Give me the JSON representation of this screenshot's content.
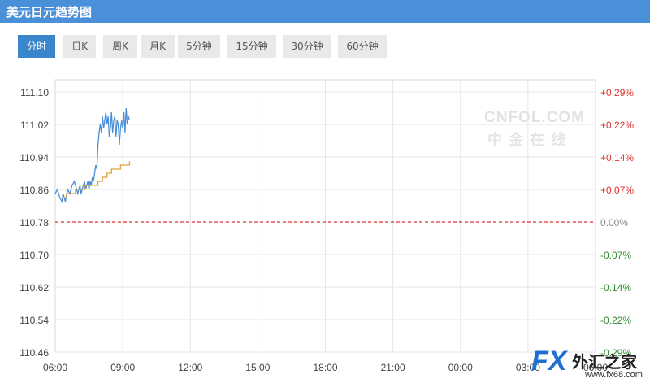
{
  "header": {
    "title": "美元日元趋势图"
  },
  "tabs": [
    {
      "label": "分时",
      "active": true
    },
    {
      "label": "日K",
      "active": false
    },
    {
      "label": "周K",
      "active": false
    },
    {
      "label": "月K",
      "active": false
    },
    {
      "label": "5分钟",
      "active": false
    },
    {
      "label": "15分钟",
      "active": false
    },
    {
      "label": "30分钟",
      "active": false
    },
    {
      "label": "60分钟",
      "active": false
    }
  ],
  "watermark": {
    "line1": "CNFOL.COM",
    "line2": "中金在线"
  },
  "logo": {
    "fx": "FX",
    "name": "外汇之家",
    "url": "www.fx68.com"
  },
  "colors": {
    "accent": "#3a86cc",
    "title_bar": "#4a90d9",
    "up": "#e03030",
    "down": "#2e8b2e",
    "price_line": "#4a8fd6",
    "avg_line": "#e0a040",
    "baseline": "#e03030"
  },
  "chart_data": {
    "type": "line",
    "title": "",
    "xlabel": "",
    "ylabel": "",
    "ylim": [
      110.46,
      111.1
    ],
    "base_price": 110.78,
    "y_ticks": [
      "111.10",
      "111.02",
      "110.94",
      "110.86",
      "110.78",
      "110.70",
      "110.62",
      "110.54",
      "110.46"
    ],
    "pct_ticks": [
      "+0.29%",
      "+0.22%",
      "+0.14%",
      "+0.07%",
      "0.00%",
      "-0.07%",
      "-0.14%",
      "-0.22%",
      "-0.29%"
    ],
    "x_ticks": [
      "06:00",
      "09:00",
      "12:00",
      "15:00",
      "18:00",
      "21:00",
      "00:00",
      "03:00",
      "06:00"
    ],
    "x_range_hours": [
      0,
      24
    ],
    "grid": true,
    "series": [
      {
        "kind": "price",
        "x": [
          0.0,
          0.1,
          0.2,
          0.3,
          0.35,
          0.45,
          0.55,
          0.65,
          0.75,
          0.85,
          0.95,
          1.0,
          1.05,
          1.1,
          1.15,
          1.25,
          1.3,
          1.35,
          1.4,
          1.45,
          1.5,
          1.55,
          1.6,
          1.65,
          1.7,
          1.75,
          1.8,
          1.85,
          1.9,
          1.95,
          2.0,
          2.05,
          2.1,
          2.15,
          2.2,
          2.25,
          2.3,
          2.35,
          2.4,
          2.45,
          2.5,
          2.55,
          2.6,
          2.65,
          2.7,
          2.75,
          2.8,
          2.85,
          2.9,
          2.95,
          3.0,
          3.05,
          3.1,
          3.15,
          3.2,
          3.25,
          3.3
        ],
        "y": [
          110.85,
          110.86,
          110.84,
          110.83,
          110.85,
          110.83,
          110.86,
          110.85,
          110.87,
          110.88,
          110.86,
          110.85,
          110.86,
          110.87,
          110.85,
          110.87,
          110.88,
          110.86,
          110.87,
          110.88,
          110.86,
          110.88,
          110.87,
          110.89,
          110.88,
          110.9,
          110.92,
          110.91,
          110.97,
          111.0,
          111.02,
          111.0,
          111.04,
          111.01,
          111.03,
          111.05,
          111.02,
          111.04,
          110.99,
          111.01,
          111.05,
          111.0,
          111.03,
          111.04,
          110.99,
          111.03,
          111.02,
          110.97,
          111.01,
          111.03,
          111.01,
          111.05,
          111.0,
          111.06,
          111.02,
          111.04,
          111.03
        ]
      },
      {
        "kind": "average",
        "x": [
          0.3,
          0.5,
          0.7,
          0.9,
          1.1,
          1.3,
          1.5,
          1.7,
          1.9,
          2.1,
          2.3,
          2.5,
          2.7,
          2.9,
          3.1,
          3.3
        ],
        "y": [
          110.84,
          110.85,
          110.85,
          110.86,
          110.86,
          110.87,
          110.87,
          110.87,
          110.88,
          110.89,
          110.9,
          110.91,
          110.91,
          110.92,
          110.92,
          110.93
        ]
      },
      {
        "kind": "reference",
        "x": [
          7.8,
          24
        ],
        "y": [
          111.021,
          111.021
        ]
      }
    ]
  }
}
